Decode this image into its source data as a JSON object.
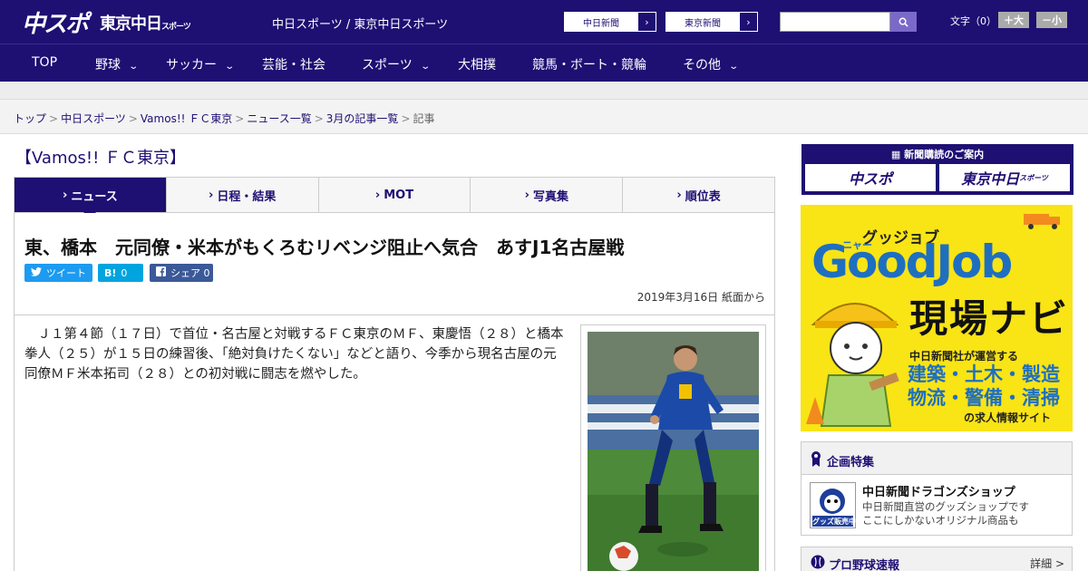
{
  "header": {
    "logo_chuspo": "中スポ",
    "logo_tokyo": "東京中日",
    "logo_tokyo_small": "スポーツ",
    "site_title": "中日スポーツ / 東京中日スポーツ",
    "paper_links": [
      "中日新聞",
      "東京新聞"
    ],
    "search_placeholder": "",
    "font_size_label": "文字（0）",
    "font_bigger": "＋大",
    "font_smaller": "－小",
    "brand_color": "#1e0f73"
  },
  "nav": {
    "items": [
      {
        "label": "TOP",
        "dropdown": false
      },
      {
        "label": "野球",
        "dropdown": true
      },
      {
        "label": "サッカー",
        "dropdown": true
      },
      {
        "label": "芸能・社会",
        "dropdown": false
      },
      {
        "label": "スポーツ",
        "dropdown": true
      },
      {
        "label": "大相撲",
        "dropdown": false
      },
      {
        "label": "競馬・ボート・競輪",
        "dropdown": false
      },
      {
        "label": "その他",
        "dropdown": true
      }
    ]
  },
  "breadcrumb": {
    "items": [
      "トップ",
      "中日スポーツ",
      "Vamos!! ＦＣ東京",
      "ニュース一覧",
      "3月の記事一覧"
    ],
    "current": "記事",
    "separator": ">"
  },
  "section": {
    "title": "【Vamos!! ＦＣ東京】"
  },
  "tabs": [
    {
      "label": "ニュース",
      "active": true
    },
    {
      "label": "日程・結果",
      "active": false
    },
    {
      "label": "MOT",
      "active": false
    },
    {
      "label": "写真集",
      "active": false
    },
    {
      "label": "順位表",
      "active": false
    }
  ],
  "article": {
    "headline": "東、橋本　元同僚・米本がもくろむリベンジ阻止へ気合　あすJ1名古屋戦",
    "share": {
      "tweet": "ツイート",
      "hatena_icon": "B!",
      "hatena_count": "0",
      "facebook_label": "シェア",
      "facebook_count": "0"
    },
    "date": "2019年3月16日 紙面から",
    "lead": "　Ｊ１第４節（１７日）で首位・名古屋と対戦するＦＣ東京のＭＦ、東慶悟（２８）と橋本拳人（２５）が１５日の練習後、「絶対負けたくない」などと語り、今季から現名古屋の元同僚ＭＦ米本拓司（２８）との初対戦に闘志を燃やした。"
  },
  "sidebar": {
    "subscribe": {
      "title": "新聞購読のご案内",
      "chuspo": "中スポ",
      "tokyo": "東京中日",
      "tokyo_small": "スポーツ"
    },
    "ad": {
      "kana": "グッジョブ",
      "brand": "GoodJob",
      "navi": "現場ナビ",
      "sub": "中日新聞社が運営する",
      "line1": "建築・土木・製造",
      "line2": "物流・警備・清掃",
      "foot": "の求人情報サイト",
      "helmet_text": "ニャー"
    },
    "feature": {
      "title": "企画特集",
      "shop_title": "中日新聞ドラゴンズショップ",
      "shop_desc1": "中日新聞直営のグッズショップです",
      "shop_desc2": "ここにしかないオリジナル商品も",
      "thumb_text": "グッズ販売中"
    },
    "baseball": {
      "title": "プロ野球速報",
      "more": "詳細 >"
    }
  }
}
